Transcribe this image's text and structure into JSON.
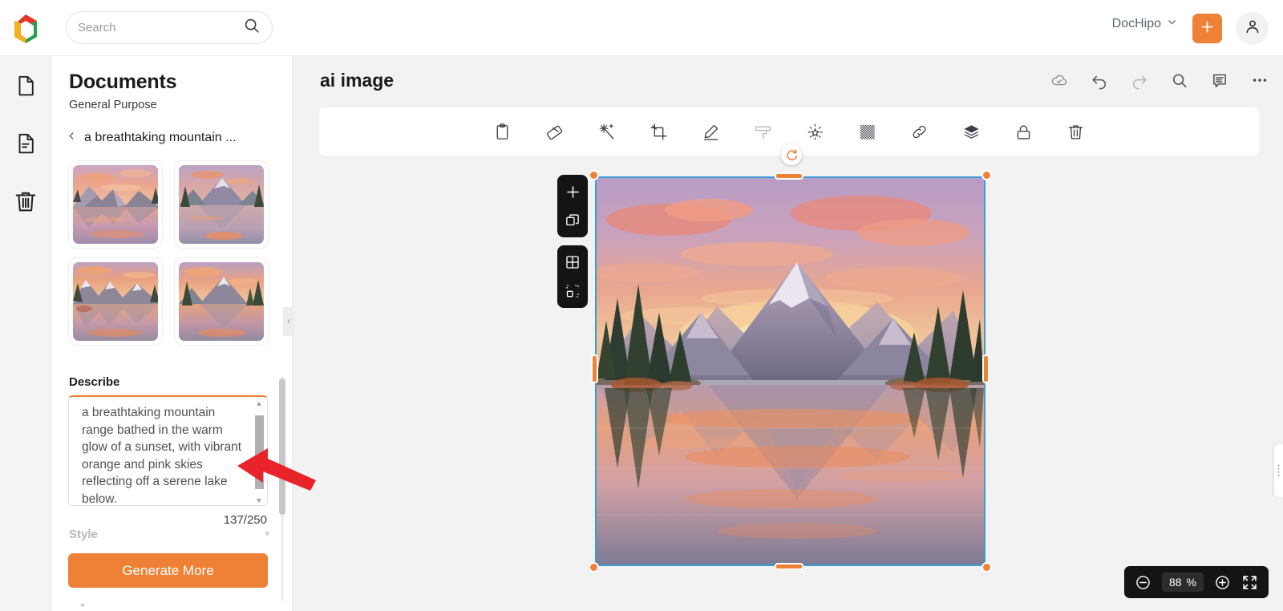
{
  "topbar": {
    "logo_name": "dochipo-logo",
    "search": {
      "placeholder": "Search",
      "value": "",
      "icon": "search-icon"
    },
    "workspace_label": "DocHipo",
    "workspace_chevron": "chevron-down-icon",
    "create_button_icon": "plus-icon",
    "account_icon": "user-avatar-icon"
  },
  "rail": {
    "items": [
      {
        "icon": "blank-page-icon",
        "name": "rail-item-blank-page"
      },
      {
        "icon": "document-icon",
        "name": "rail-item-documents"
      },
      {
        "icon": "trash-icon",
        "name": "rail-item-trash"
      }
    ]
  },
  "panel": {
    "title": "Documents",
    "subtitle": "General Purpose",
    "breadcrumb": {
      "back_icon": "chevron-left-icon",
      "label": "a breathtaking mountain ..."
    },
    "thumbnails": [
      {
        "name": "ai-thumbnail-1",
        "alt": "mountain sunset lake 1"
      },
      {
        "name": "ai-thumbnail-2",
        "alt": "mountain sunset lake 2"
      },
      {
        "name": "ai-thumbnail-3",
        "alt": "mountain sunset lake 3"
      },
      {
        "name": "ai-thumbnail-4",
        "alt": "mountain sunset lake 4"
      }
    ],
    "describe": {
      "label": "Describe",
      "value": "a breathtaking mountain range bathed in the warm glow of a sunset, with vibrant orange and pink skies reflecting off a serene lake below.",
      "char_count": "137/250",
      "scroll_up_icon": "caret-up-icon",
      "scroll_down_icon": "caret-down-icon"
    },
    "next_section_label": "Style",
    "generate_button": "Generate More",
    "collapse_icon": "chevron-left-icon"
  },
  "main": {
    "doc_title": "ai image",
    "header_actions": [
      {
        "icon": "cloud-saved-icon",
        "name": "cloud-save-status-icon"
      },
      {
        "icon": "undo-icon",
        "name": "undo-button"
      },
      {
        "icon": "redo-icon",
        "name": "redo-button"
      },
      {
        "icon": "search-icon",
        "name": "canvas-search-button"
      },
      {
        "icon": "comment-icon",
        "name": "comments-button"
      },
      {
        "icon": "more-horizontal-icon",
        "name": "more-options-button"
      }
    ],
    "element_toolbar": [
      {
        "icon": "clipboard-icon",
        "name": "copy-style-button"
      },
      {
        "icon": "eraser-icon",
        "name": "background-remover-button"
      },
      {
        "icon": "magic-wand-icon",
        "name": "ai-edit-button"
      },
      {
        "icon": "crop-icon",
        "name": "crop-button"
      },
      {
        "icon": "pencil-icon",
        "name": "draw-button"
      },
      {
        "icon": "paint-roller-icon",
        "name": "paint-button"
      },
      {
        "icon": "brightness-icon",
        "name": "adjust-button"
      },
      {
        "icon": "transparency-icon",
        "name": "transparency-button"
      },
      {
        "icon": "link-icon",
        "name": "link-button"
      },
      {
        "icon": "layers-icon",
        "name": "layers-button"
      },
      {
        "icon": "lock-icon",
        "name": "lock-button"
      },
      {
        "icon": "trash-icon",
        "name": "delete-button"
      }
    ],
    "side_tools": [
      {
        "icon": "plus-icon",
        "name": "add-page-button"
      },
      {
        "icon": "duplicate-icon",
        "name": "duplicate-page-button"
      },
      {
        "icon": "grid-icon",
        "name": "grid-view-button"
      },
      {
        "icon": "selection-icon",
        "name": "select-area-button"
      }
    ],
    "selection": {
      "rotate_icon": "rotate-handle-icon",
      "image_alt": "AI generated mountain sunset lake landscape"
    },
    "zoom": {
      "out_icon": "zoom-out-icon",
      "value": "88",
      "unit": "%",
      "in_icon": "zoom-in-icon",
      "fullscreen_icon": "fullscreen-icon"
    },
    "right_tab_icon": "panel-expand-icon"
  },
  "colors": {
    "brand_orange": "#ef8136",
    "selection_blue": "#3b9dd8",
    "dark_panel": "#141414",
    "canvas_bg": "#f2f2f2",
    "cursor_red": "#e8232a"
  }
}
